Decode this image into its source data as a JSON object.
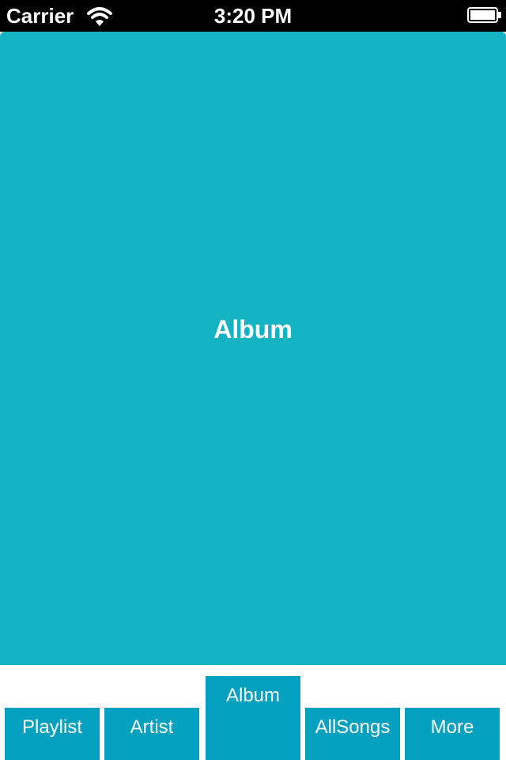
{
  "status_bar": {
    "carrier": "Carrier",
    "time": "3:20 PM",
    "wifi_icon": "wifi-icon",
    "battery_icon": "battery-icon"
  },
  "main": {
    "title": "Album",
    "background_color": "#14b3c3"
  },
  "tab_bar": {
    "accent_color": "#03a1bf",
    "selected": "Album",
    "tabs": [
      {
        "label": "Playlist"
      },
      {
        "label": "Artist"
      },
      {
        "label": "Album"
      },
      {
        "label": "AllSongs"
      },
      {
        "label": "More"
      }
    ]
  }
}
